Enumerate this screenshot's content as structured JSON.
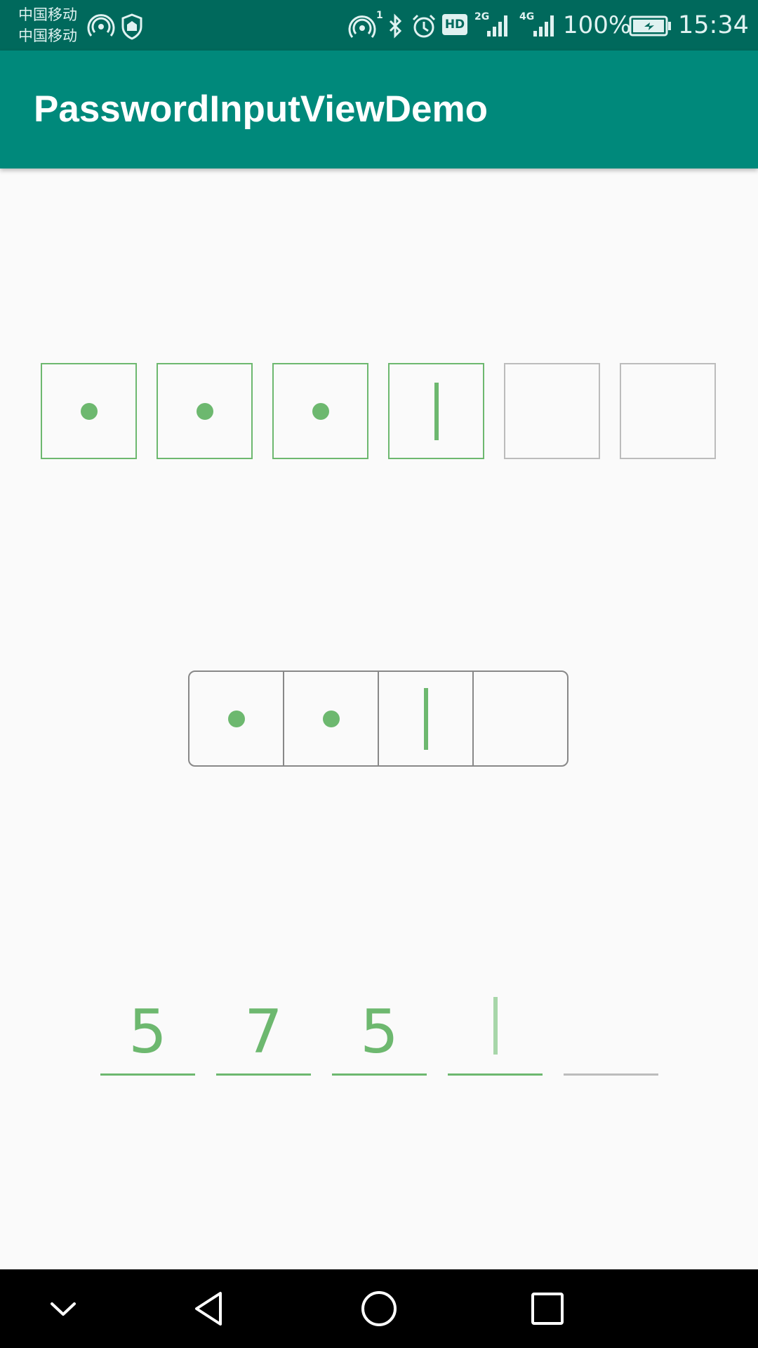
{
  "status_bar": {
    "carrier_1": "中国移动",
    "carrier_2": "中国移动",
    "hotspot_count": "1",
    "network_2g": "2G",
    "network_4g": "4G",
    "hd_badge": "HD",
    "battery_percent": "100%",
    "time": "15:34"
  },
  "app_bar": {
    "title": "PasswordInputViewDemo"
  },
  "password_views": [
    {
      "style": "separate-boxes",
      "length": 6,
      "filled": 3,
      "cursor_index": 3
    },
    {
      "style": "connected-boxes",
      "length": 4,
      "filled": 2,
      "cursor_index": 2
    },
    {
      "style": "underline",
      "length": 5,
      "digits": [
        "5",
        "7",
        "5"
      ],
      "cursor_index": 3
    }
  ],
  "colors": {
    "status_bar": "#00695c",
    "app_bar": "#00897b",
    "accent_green": "#6db86f",
    "inactive_border": "#bcbcbc",
    "group_border": "#888888",
    "background": "#fafafa",
    "nav_bar": "#000000"
  },
  "nav_bar": {
    "icons": [
      "chevron-down-icon",
      "back-triangle-icon",
      "home-circle-icon",
      "recents-square-icon"
    ]
  }
}
